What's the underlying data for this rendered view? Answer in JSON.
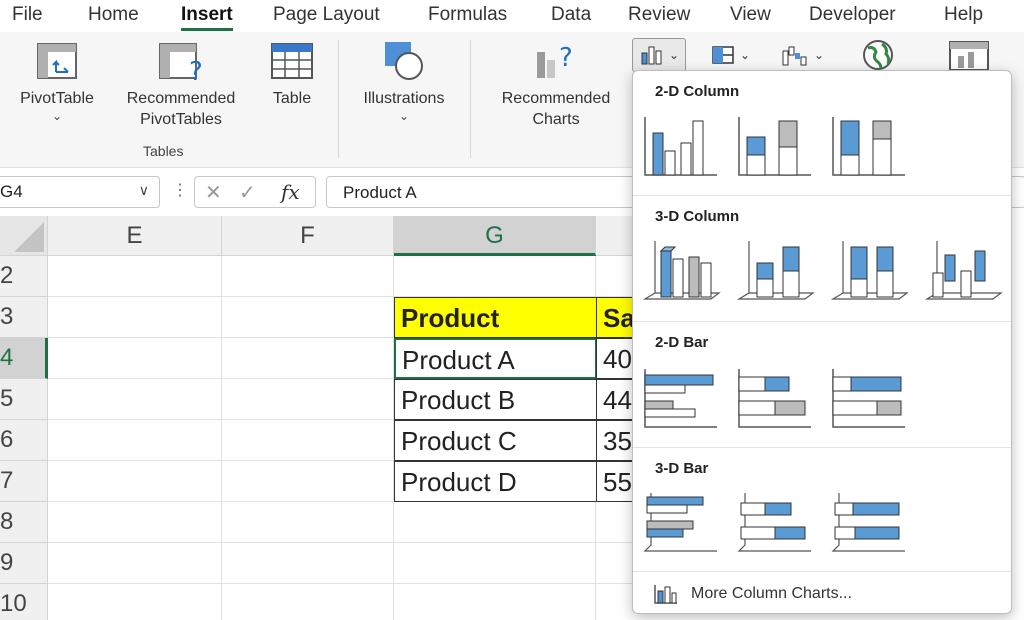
{
  "menu": {
    "items": [
      "File",
      "Home",
      "Insert",
      "Page Layout",
      "Formulas",
      "Data",
      "Review",
      "View",
      "Developer",
      "Help"
    ],
    "active": "Insert"
  },
  "ribbon": {
    "pivottable": "PivotTable",
    "recommended_pivottables_line1": "Recommended",
    "recommended_pivottables_line2": "PivotTables",
    "table": "Table",
    "tables_group": "Tables",
    "illustrations": "Illustrations",
    "recommended_charts_line1": "Recommended",
    "recommended_charts_line2": "Charts",
    "caret": "⌄",
    "small_caret": "⌄"
  },
  "formula_bar": {
    "name_box": "G4",
    "formula": "Product A",
    "fx": "fx",
    "cancel": "✕",
    "enter": "✓"
  },
  "grid": {
    "columns": [
      "E",
      "F",
      "G"
    ],
    "selected_column": "G",
    "rows": [
      "2",
      "3",
      "4",
      "5",
      "6",
      "7",
      "8",
      "9",
      "10"
    ],
    "selected_row": "4",
    "table": {
      "headers": [
        "Product",
        "Sa"
      ],
      "rows": [
        [
          "Product A",
          "40"
        ],
        [
          "Product B",
          "44"
        ],
        [
          "Product C",
          "35"
        ],
        [
          "Product D",
          "55"
        ]
      ]
    }
  },
  "dropdown": {
    "sections": [
      "2-D Column",
      "3-D Column",
      "2-D Bar",
      "3-D Bar"
    ],
    "more": "More Column Charts..."
  },
  "colors": {
    "accent_green": "#1e7145",
    "chart_blue": "#5b9bd5",
    "header_yellow": "#ffff00"
  }
}
